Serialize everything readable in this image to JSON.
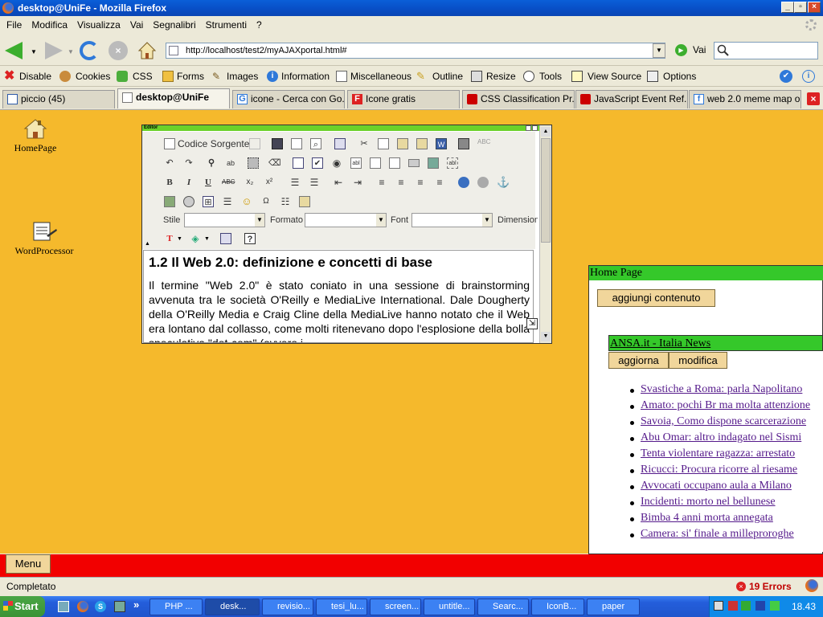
{
  "window": {
    "title": "desktop@UniFe - Mozilla Firefox"
  },
  "menubar": {
    "items": [
      "File",
      "Modifica",
      "Visualizza",
      "Vai",
      "Segnalibri",
      "Strumenti",
      "?"
    ]
  },
  "navbar": {
    "url": "http://localhost/test2/myAJAXportal.html#",
    "go_label": "Vai"
  },
  "devtoolbar": {
    "items": [
      "Disable",
      "Cookies",
      "CSS",
      "Forms",
      "Images",
      "Information",
      "Miscellaneous",
      "Outline",
      "Resize",
      "Tools",
      "View Source",
      "Options"
    ]
  },
  "tabs": [
    {
      "label": "piccio (45)"
    },
    {
      "label": "desktop@UniFe"
    },
    {
      "label": "icone - Cerca con Go..."
    },
    {
      "label": "Icone gratis"
    },
    {
      "label": "CSS Classification Pr..."
    },
    {
      "label": "JavaScript Event Ref..."
    },
    {
      "label": "web 2.0 meme map o..."
    }
  ],
  "desktop": {
    "icons": [
      {
        "label": "HomePage"
      },
      {
        "label": "WordProcessor"
      }
    ]
  },
  "editor": {
    "window_title": "Editor",
    "source_label": "Codice Sorgente",
    "style_label": "Stile",
    "format_label": "Formato",
    "font_label": "Font",
    "size_label": "Dimensione",
    "doc_title": "1.2 Il Web 2.0: definizione e concetti di base",
    "doc_text": "Il termine \"Web 2.0\" è stato coniato in una sessione di brainstorming avvenuta tra le società O'Reilly e MediaLive International. Dale Dougherty della O'Reilly Media e Craig Cline della MediaLive hanno notato che il Web era lontano dal collasso, come molti ritenevano dopo l'esplosione della bolla speculativa \"dot-com\" (ovvero i"
  },
  "homepage": {
    "title": "Home Page",
    "add_button": "aggiungi contenuto",
    "feed": {
      "title": "ANSA.it - Italia News",
      "refresh_label": "aggiorna",
      "edit_label": "modifica",
      "news": [
        "Svastiche a Roma: parla Napolitano",
        "Amato: pochi Br ma molta attenzione",
        "Savoia, Como dispone scarcerazione",
        "Abu Omar: altro indagato nel Sismi",
        "Tenta violentare ragazza: arrestato",
        "Ricucci: Procura ricorre al riesame",
        "Avvocati occupano aula a Milano",
        "Incidenti: morto nel bellunese",
        "Bimba 4 anni morta annegata",
        "Camera: si' finale a milleproroghe"
      ]
    }
  },
  "bottom": {
    "menu_label": "Menu"
  },
  "status": {
    "text": "Completato",
    "errors": "19 Errors"
  },
  "taskbar": {
    "start": "Start",
    "tasks": [
      "PHP ...",
      "desk...",
      "revisio...",
      "tesi_lu...",
      "screen...",
      "untitle...",
      "Searc...",
      "IconB...",
      "paper"
    ],
    "clock": "18.43"
  },
  "colors": {
    "desktop_bg": "#F5B92C",
    "header_green": "#35C82A",
    "menu_red": "#F20000",
    "button_tan": "#F1D69B",
    "link": "#551A8B"
  }
}
